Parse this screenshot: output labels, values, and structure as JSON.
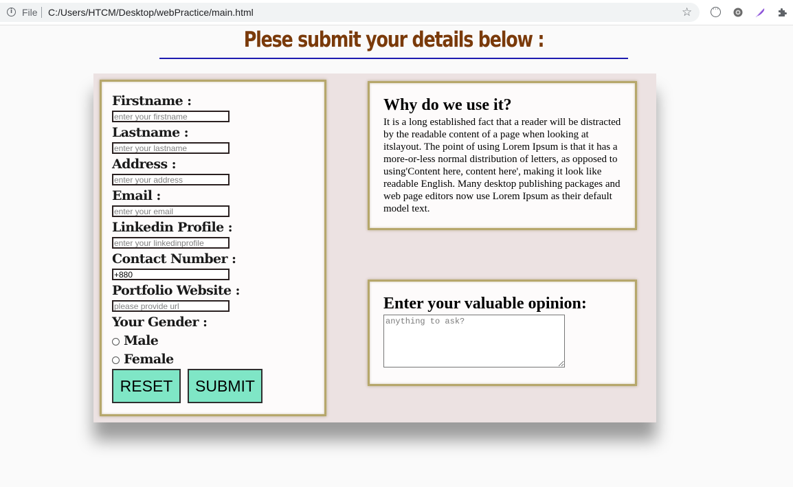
{
  "browser": {
    "file_label": "File",
    "url": "C:/Users/HTCM/Desktop/webPractice/main.html",
    "icons": [
      "info-icon",
      "star-icon",
      "extension-loop-icon",
      "extension-gear-icon",
      "extension-feather-icon",
      "extensions-puzzle-icon"
    ]
  },
  "page": {
    "heading": "Plese submit your details below :",
    "heading_color": "#7a3a0a",
    "rule_color": "#1d1bb0",
    "panel_color": "#ece2e2"
  },
  "form": {
    "fields": [
      {
        "label": "Firstname :",
        "placeholder": "enter your firstname",
        "value": ""
      },
      {
        "label": "Lastname :",
        "placeholder": "enter your lastname",
        "value": ""
      },
      {
        "label": "Address :",
        "placeholder": "enter your address",
        "value": ""
      },
      {
        "label": "Email :",
        "placeholder": "enter your email",
        "value": ""
      },
      {
        "label": "Linkedin Profile :",
        "placeholder": "enter your linkedinprofile",
        "value": ""
      },
      {
        "label": "Contact Number :",
        "placeholder": "",
        "value": "+880"
      },
      {
        "label": "Portfolio Website :",
        "placeholder": "please provide url",
        "value": ""
      }
    ],
    "gender_label": "Your Gender :",
    "gender_options": [
      "Male",
      "Female"
    ],
    "reset_label": "RESET",
    "submit_label": "SUBMIT",
    "button_color": "#7fe6c6"
  },
  "info": {
    "title": "Why do we use it?",
    "text": "It is a long established fact that a reader will be distracted by the readable content of a page when looking at itslayout. The point of using Lorem Ipsum is that it has a more-or-less normal distribution of letters, as opposed to using'Content here, content here', making it look like readable English. Many desktop publishing packages and web page editors now use Lorem Ipsum as their default model text."
  },
  "opinion": {
    "title": "Enter your valuable opinion:",
    "placeholder": "anything to ask?"
  }
}
